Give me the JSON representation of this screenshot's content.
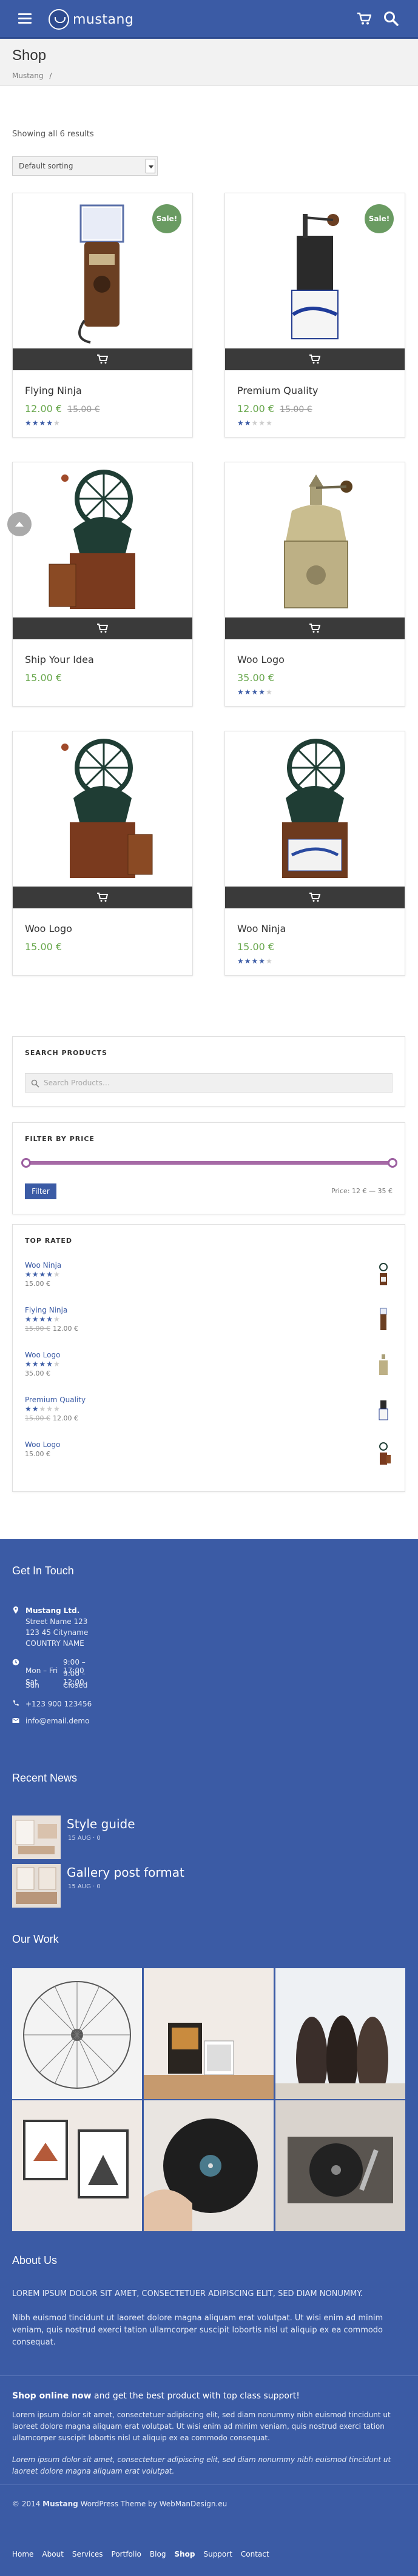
{
  "header": {
    "logo_text": "mustang",
    "accent": "#3b5ba5"
  },
  "page": {
    "title": "Shop",
    "breadcrumb": [
      "Mustang",
      "/"
    ]
  },
  "shop": {
    "result_count": "Showing all 6 results",
    "sort_selected": "Default sorting",
    "sale_label": "Sale!",
    "products": [
      {
        "name": "Flying Ninja",
        "price": "12.00 €",
        "old_price": "15.00 €",
        "sale": true,
        "rating": 4
      },
      {
        "name": "Premium Quality",
        "price": "12.00 €",
        "old_price": "15.00 €",
        "sale": true,
        "rating": 2
      },
      {
        "name": "Ship Your Idea",
        "price": "15.00 €",
        "old_price": "",
        "sale": false,
        "rating": 0
      },
      {
        "name": "Woo Logo",
        "price": "35.00 €",
        "old_price": "",
        "sale": false,
        "rating": 4
      },
      {
        "name": "Woo Logo",
        "price": "15.00 €",
        "old_price": "",
        "sale": false,
        "rating": 0
      },
      {
        "name": "Woo Ninja",
        "price": "15.00 €",
        "old_price": "",
        "sale": false,
        "rating": 4
      }
    ]
  },
  "widgets": {
    "search": {
      "title": "SEARCH PRODUCTS",
      "placeholder": "Search Products…"
    },
    "price_filter": {
      "title": "FILTER BY PRICE",
      "button": "Filter",
      "range": "Price: 12 € — 35 €",
      "min_fraction": 0.0,
      "max_fraction": 1.0
    },
    "top_rated": {
      "title": "TOP RATED",
      "items": [
        {
          "name": "Woo Ninja",
          "rating": 4,
          "old_price": "",
          "price": "15.00 €"
        },
        {
          "name": "Flying Ninja",
          "rating": 4,
          "old_price": "15.00 €",
          "price": "12.00 €"
        },
        {
          "name": "Woo Logo",
          "rating": 4,
          "old_price": "",
          "price": "35.00 €"
        },
        {
          "name": "Premium Quality",
          "rating": 2,
          "old_price": "15.00 €",
          "price": "12.00 €"
        },
        {
          "name": "Woo Logo",
          "rating": 0,
          "old_price": "",
          "price": "15.00 €"
        }
      ]
    }
  },
  "footer": {
    "contact": {
      "heading": "Get In Touch",
      "company": "Mustang Ltd.",
      "street": "Street Name 123",
      "city": "123 45 Cityname",
      "country": "COUNTRY NAME",
      "hours": [
        {
          "day": "Mon – Fri",
          "time": "9:00 – 17:00"
        },
        {
          "day": "Sat",
          "time": "9:00 – 12:00"
        },
        {
          "day": "Sun",
          "time": "Closed"
        }
      ],
      "phone": "+123 900 123456",
      "email": "info@email.demo"
    },
    "news": {
      "heading": "Recent News",
      "items": [
        {
          "title": "Style guide",
          "meta": "15 AUG  ·  0"
        },
        {
          "title": "Gallery post format",
          "meta": "15 AUG  ·  0"
        }
      ]
    },
    "work": {
      "heading": "Our Work"
    },
    "about": {
      "heading": "About Us",
      "caps": "LOREM IPSUM DOLOR SIT AMET, CONSECTETUER ADIPISCING ELIT, SED DIAM NONUMMY.",
      "text": "Nibh euismod tincidunt ut laoreet dolore magna aliquam erat volutpat. Ut wisi enim ad minim veniam, quis nostrud exerci tation ullamcorper suscipit lobortis nisl ut aliquip ex ea commodo consequat."
    },
    "promo": {
      "bold": "Shop online now",
      "rest": " and get the best product with top class support!",
      "p1": "Lorem ipsum dolor sit amet, consectetuer adipiscing elit, sed diam nonummy nibh euismod tincidunt ut laoreet dolore magna aliquam erat volutpat. Ut wisi enim ad minim veniam, quis nostrud exerci tation ullamcorper suscipit lobortis nisl ut aliquip ex ea commodo consequat.",
      "p2": "Lorem ipsum dolor sit amet, consectetuer adipiscing elit, sed diam nonummy nibh euismod tincidunt ut laoreet dolore magna aliquam erat volutpat."
    },
    "copyright": {
      "prefix": "© 2014 ",
      "brand": "Mustang",
      "middle": " WordPress Theme by ",
      "author": "WebManDesign.eu"
    },
    "nav": [
      "Home",
      "About",
      "Services",
      "Portfolio",
      "Blog",
      "Shop",
      "Support",
      "Contact"
    ],
    "nav_active": "Shop"
  }
}
